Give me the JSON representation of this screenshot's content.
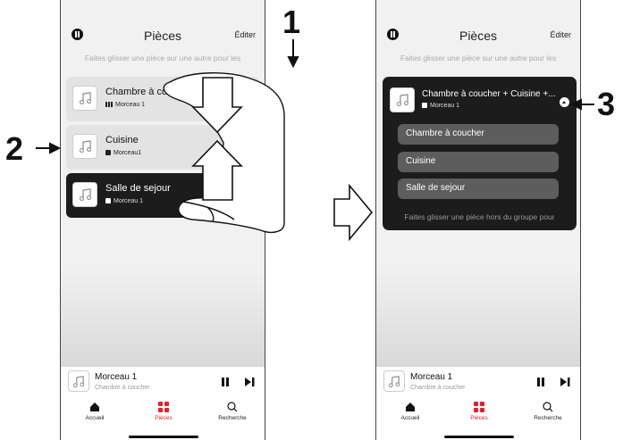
{
  "left": {
    "header": {
      "title": "Pièces",
      "edit_label": "Éditer"
    },
    "hint": "Faites glisser une pièce sur une autre pour les",
    "rooms": [
      {
        "name": "Chambre à coucher",
        "track": "Morceau 1",
        "indicator": "bars-icon"
      },
      {
        "name": "Cuisine",
        "track": "Morceau1",
        "indicator": "square-icon"
      },
      {
        "name": "Salle de sejour",
        "track": "Morceau 1",
        "indicator": "square-icon"
      }
    ],
    "mini_player": {
      "title": "Morceau 1",
      "subtitle": "Chambre à coucher"
    },
    "tabs": [
      {
        "label": "Accueil",
        "icon": "home-icon"
      },
      {
        "label": "Pièces",
        "icon": "rooms-icon"
      },
      {
        "label": "Recherche",
        "icon": "search-icon"
      }
    ]
  },
  "right": {
    "header": {
      "title": "Pièces",
      "edit_label": "Éditer"
    },
    "hint": "Faites glisser une pièce sur une autre pour les",
    "group": {
      "name": "Chambre à coucher + Cuisine +...",
      "track": "Morceau 1",
      "members": [
        "Chambre à coucher",
        "Cuisine",
        "Salle de sejour"
      ],
      "hint": "Faites glisser une pièce hors du groupe pour"
    },
    "mini_player": {
      "title": "Morceau 1",
      "subtitle": "Chambre à coucher"
    },
    "tabs": [
      {
        "label": "Accueil",
        "icon": "home-icon"
      },
      {
        "label": "Pièces",
        "icon": "rooms-icon"
      },
      {
        "label": "Recherche",
        "icon": "search-icon"
      }
    ]
  },
  "callouts": {
    "one": "1",
    "two": "2",
    "three": "3"
  },
  "colors": {
    "accent": "#e2212b",
    "dark_card": "#1c1c1c",
    "chip": "#5d5d5d"
  }
}
